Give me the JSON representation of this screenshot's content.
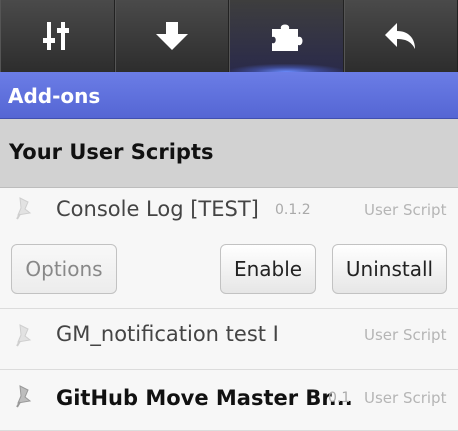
{
  "toolbar": {
    "tabs": [
      {
        "icon": "sliders-icon"
      },
      {
        "icon": "download-arrow-icon"
      },
      {
        "icon": "puzzle-piece-icon",
        "active": true
      },
      {
        "icon": "back-arrow-icon"
      }
    ]
  },
  "header": {
    "title": "Add-ons"
  },
  "section": {
    "title": "Your User Scripts"
  },
  "scripts": [
    {
      "name": "Console Log [TEST]",
      "version": "0.1.2",
      "kind": "User Script",
      "buttons": {
        "options": "Options",
        "enable": "Enable",
        "uninstall": "Uninstall"
      }
    },
    {
      "name": "GM_notification test I",
      "version": "",
      "kind": "User Script"
    },
    {
      "name": "GitHub Move Master Br...",
      "version": "0.1",
      "kind": "User Script"
    }
  ],
  "colors": {
    "accent": "#5f71dd",
    "toolbar": "#3a3a3a",
    "section": "#d2d2d2"
  }
}
